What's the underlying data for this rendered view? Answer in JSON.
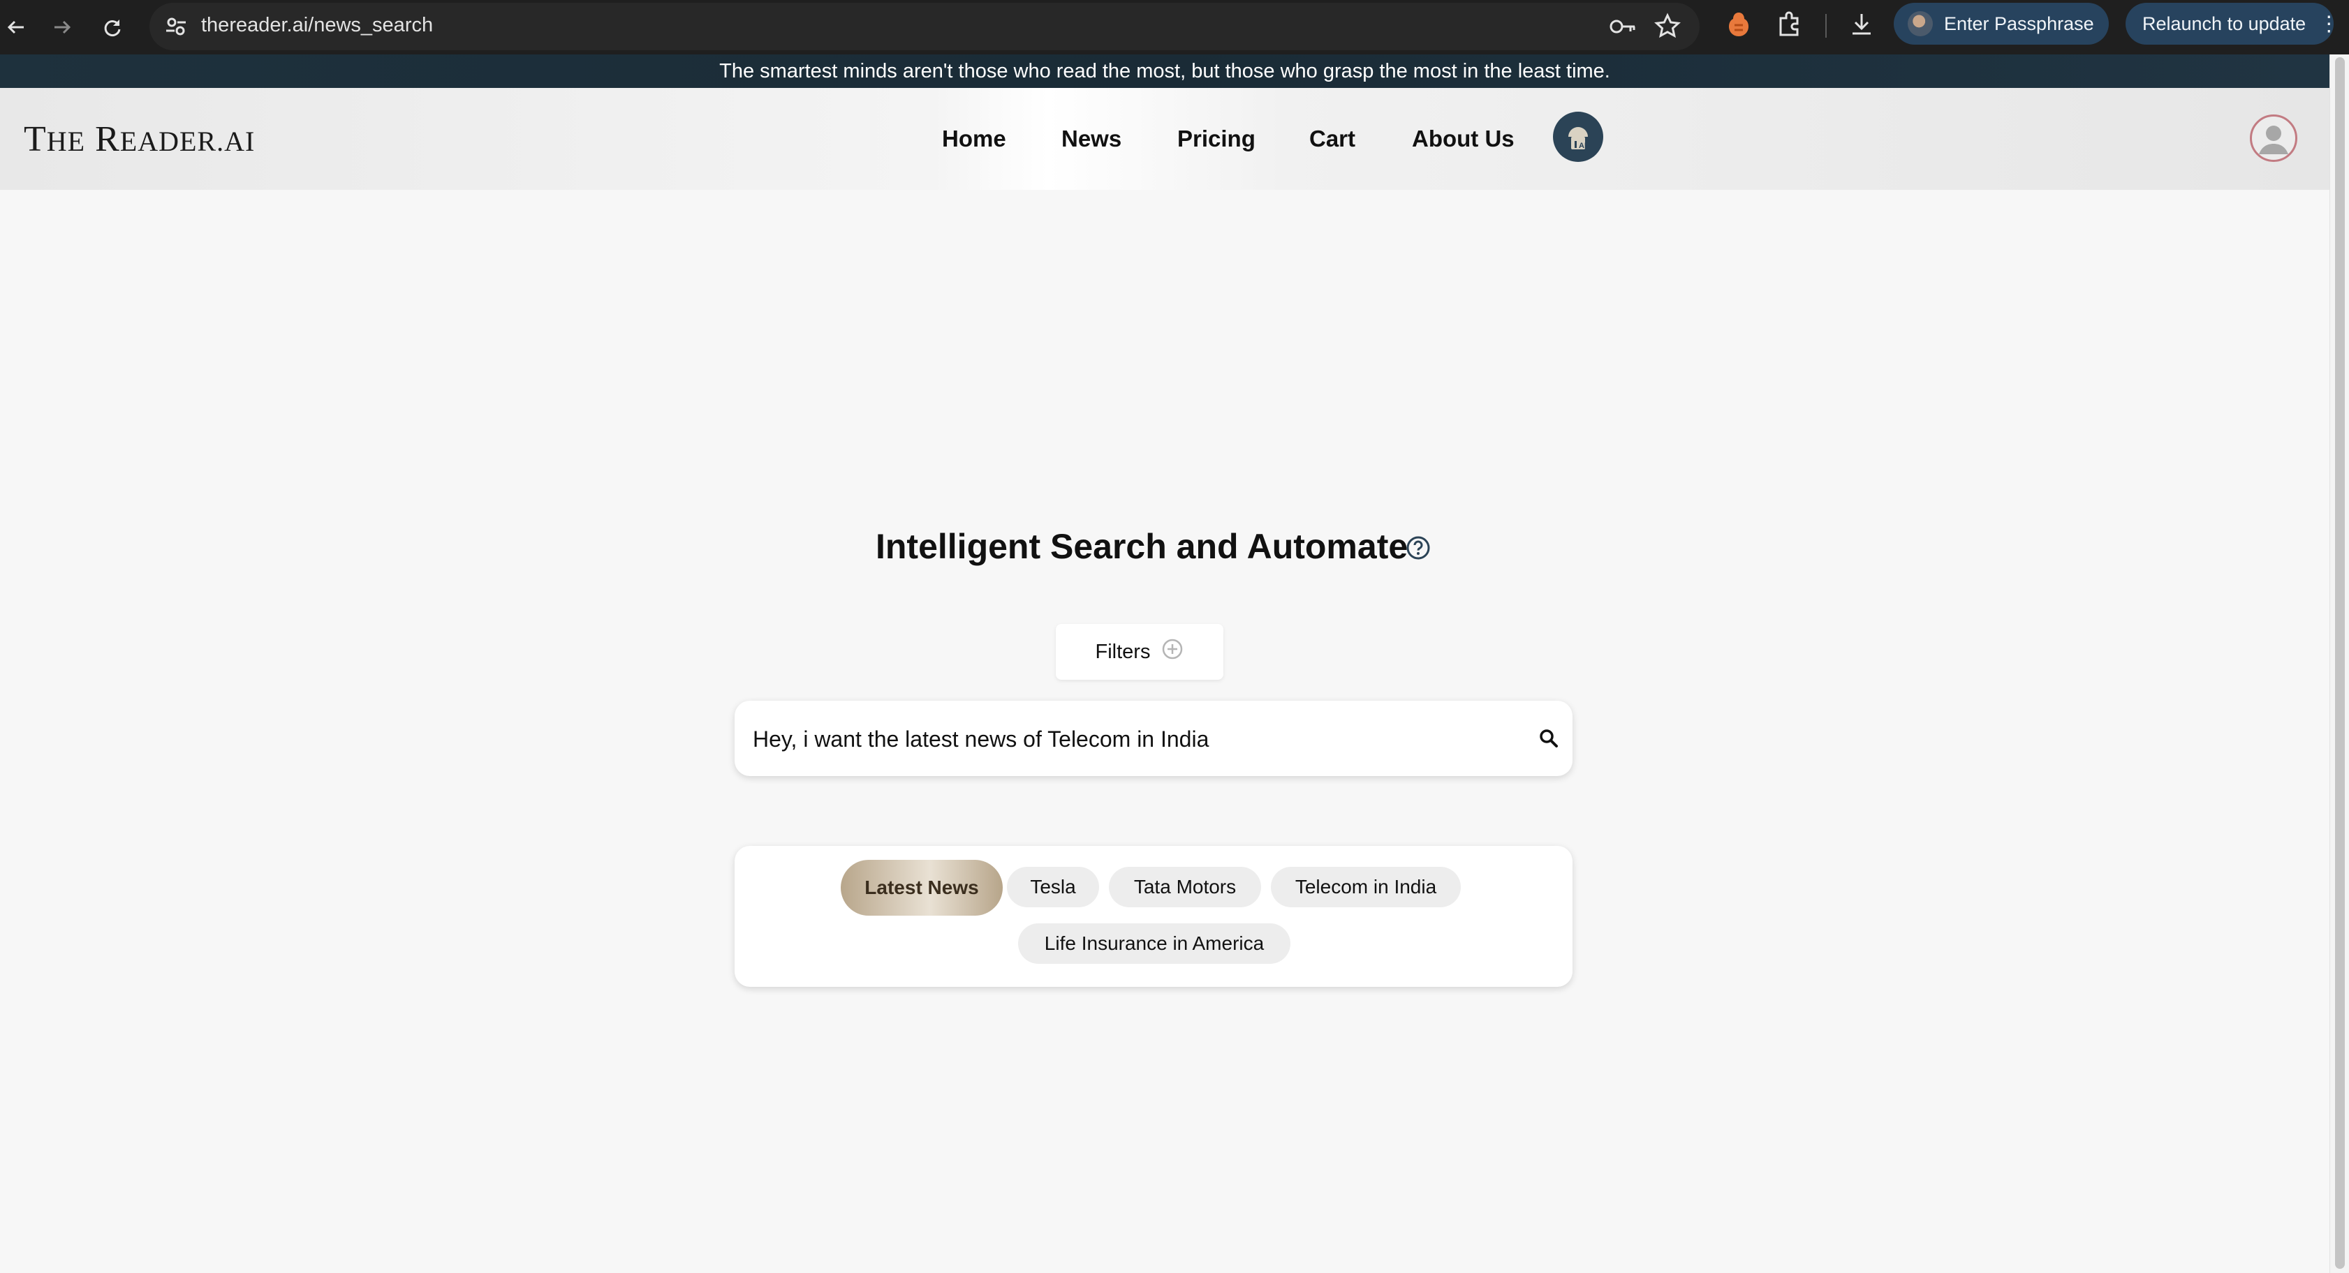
{
  "browser": {
    "url": "thereader.ai/news_search",
    "profile_label": "Enter Passphrase",
    "relaunch_label": "Relaunch to update",
    "icons": [
      "back-icon",
      "forward-icon",
      "reload-icon",
      "site-settings-icon",
      "password-key-icon",
      "bookmark-star-icon",
      "extension-icon",
      "puzzle-icon",
      "download-icon",
      "more-icon"
    ]
  },
  "banner": {
    "quote": "The smartest minds aren't those who read the most, but those who grasp the most in the least time."
  },
  "header": {
    "logo_text": "The Reader.AI",
    "nav": [
      "Home",
      "News",
      "Pricing",
      "Cart",
      "About Us"
    ]
  },
  "main": {
    "title": "Intelligent Search and Automate",
    "filters_label": "Filters",
    "search_value": "Hey, i want the latest news of Telecom in India",
    "suggestions": [
      "Latest News",
      "Tesla",
      "Tata Motors",
      "Telecom in India",
      "Life Insurance in America"
    ],
    "active_suggestion": "Latest News"
  },
  "colors": {
    "chrome_bg": "#1f1f1f",
    "banner_bg": "#1e313d",
    "accent_blue": "#2b4356",
    "chip_blue": "#27435e",
    "active_pill_gold": "#b8a68b"
  }
}
